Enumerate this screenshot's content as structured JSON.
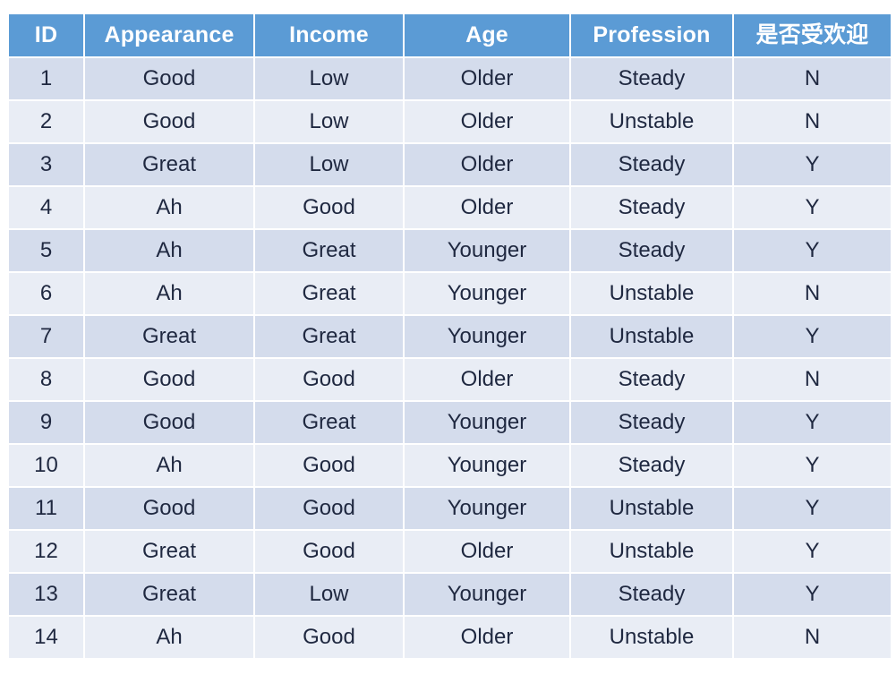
{
  "table": {
    "title": "",
    "columns": [
      {
        "key": "id",
        "label": "ID"
      },
      {
        "key": "appearance",
        "label": "Appearance"
      },
      {
        "key": "income",
        "label": "Income"
      },
      {
        "key": "age",
        "label": "Age"
      },
      {
        "key": "profession",
        "label": "Profession"
      },
      {
        "key": "popular",
        "label": "是否受欢迎"
      }
    ],
    "rows": [
      {
        "id": "1",
        "appearance": "Good",
        "income": "Low",
        "age": "Older",
        "profession": "Steady",
        "popular": "N"
      },
      {
        "id": "2",
        "appearance": "Good",
        "income": "Low",
        "age": "Older",
        "profession": "Unstable",
        "popular": "N"
      },
      {
        "id": "3",
        "appearance": "Great",
        "income": "Low",
        "age": "Older",
        "profession": "Steady",
        "popular": "Y"
      },
      {
        "id": "4",
        "appearance": "Ah",
        "income": "Good",
        "age": "Older",
        "profession": "Steady",
        "popular": "Y"
      },
      {
        "id": "5",
        "appearance": "Ah",
        "income": "Great",
        "age": "Younger",
        "profession": "Steady",
        "popular": "Y"
      },
      {
        "id": "6",
        "appearance": "Ah",
        "income": "Great",
        "age": "Younger",
        "profession": "Unstable",
        "popular": "N"
      },
      {
        "id": "7",
        "appearance": "Great",
        "income": "Great",
        "age": "Younger",
        "profession": "Unstable",
        "popular": "Y"
      },
      {
        "id": "8",
        "appearance": "Good",
        "income": "Good",
        "age": "Older",
        "profession": "Steady",
        "popular": "N"
      },
      {
        "id": "9",
        "appearance": "Good",
        "income": "Great",
        "age": "Younger",
        "profession": "Steady",
        "popular": "Y"
      },
      {
        "id": "10",
        "appearance": "Ah",
        "income": "Good",
        "age": "Younger",
        "profession": "Steady",
        "popular": "Y"
      },
      {
        "id": "11",
        "appearance": "Good",
        "income": "Good",
        "age": "Younger",
        "profession": "Unstable",
        "popular": "Y"
      },
      {
        "id": "12",
        "appearance": "Great",
        "income": "Good",
        "age": "Older",
        "profession": "Unstable",
        "popular": "Y"
      },
      {
        "id": "13",
        "appearance": "Great",
        "income": "Low",
        "age": "Younger",
        "profession": "Steady",
        "popular": "Y"
      },
      {
        "id": "14",
        "appearance": "Ah",
        "income": "Good",
        "age": "Older",
        "profession": "Unstable",
        "popular": "N"
      }
    ],
    "colors": {
      "header_background": "#5B9BD5",
      "header_text": "#FFFFFF",
      "row_odd_background": "#D4DCEC",
      "row_even_background": "#E9EDF5",
      "cell_text": "#1F2840",
      "page_background": "#FFFFFF"
    }
  }
}
